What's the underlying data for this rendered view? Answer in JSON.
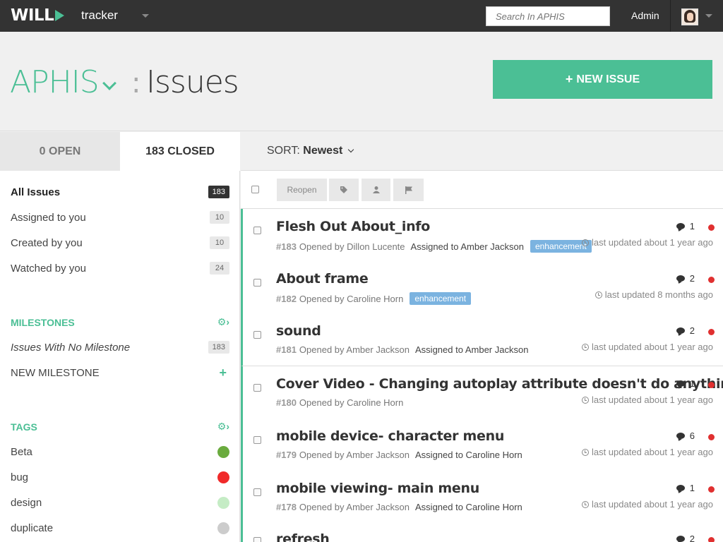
{
  "topbar": {
    "logo_text": "WILL",
    "app_name": "tracker",
    "search_placeholder": "Search In APHIS",
    "admin_label": "Admin"
  },
  "header": {
    "project": "APHIS",
    "separator": ":",
    "title": "Issues",
    "new_issue_plus": "+",
    "new_issue_label": "NEW ISSUE"
  },
  "tabs": {
    "open": "0 OPEN",
    "closed": "183 CLOSED"
  },
  "sort": {
    "label": "SORT:",
    "value": "Newest"
  },
  "filters": [
    {
      "label": "All Issues",
      "count": "183"
    },
    {
      "label": "Assigned to you",
      "count": "10"
    },
    {
      "label": "Created by you",
      "count": "10"
    },
    {
      "label": "Watched by you",
      "count": "24"
    }
  ],
  "milestones": {
    "title": "MILESTONES",
    "gear": "⚙›",
    "no_milestone_label": "Issues With No Milestone",
    "no_milestone_count": "183",
    "new_label": "NEW MILESTONE",
    "new_plus": "+"
  },
  "tags": {
    "title": "TAGS",
    "gear": "⚙›",
    "items": [
      {
        "label": "Beta",
        "color": "#6aab3e"
      },
      {
        "label": "bug",
        "color": "#f02a2a"
      },
      {
        "label": "design",
        "color": "#c5ecc5"
      },
      {
        "label": "duplicate",
        "color": "#cccccc"
      }
    ]
  },
  "toolbar": {
    "reopen": "Reopen",
    "tag_icon": "tag-icon",
    "user_icon": "user-icon",
    "flag_icon": "flag-icon"
  },
  "issues": [
    {
      "title": "Flesh Out About_info",
      "number": "#183",
      "opened": "Opened by Dillon Lucente",
      "assigned": "Assigned to Amber Jackson",
      "label": "enhancement",
      "comments": "1",
      "updated": "last updated about 1 year ago"
    },
    {
      "title": "About frame",
      "number": "#182",
      "opened": "Opened by Caroline Horn",
      "assigned": "",
      "label": "enhancement",
      "comments": "2",
      "updated": "last updated 8 months ago"
    },
    {
      "title": "sound",
      "number": "#181",
      "opened": "Opened by Amber Jackson",
      "assigned": "Assigned to Amber Jackson",
      "label": "",
      "comments": "2",
      "updated": "last updated about 1 year ago"
    },
    {
      "title": "Cover Video - Changing autoplay attribute doesn't do anything",
      "number": "#180",
      "opened": "Opened by Caroline Horn",
      "assigned": "",
      "label": "",
      "comments": "1",
      "updated": "last updated about 1 year ago"
    },
    {
      "title": "mobile device- character menu",
      "number": "#179",
      "opened": "Opened by Amber Jackson",
      "assigned": "Assigned to Caroline Horn",
      "label": "",
      "comments": "6",
      "updated": "last updated about 1 year ago"
    },
    {
      "title": "mobile viewing- main menu",
      "number": "#178",
      "opened": "Opened by Amber Jackson",
      "assigned": "Assigned to Caroline Horn",
      "label": "",
      "comments": "1",
      "updated": "last updated about 1 year ago"
    },
    {
      "title": "refresh",
      "number": "",
      "opened": "",
      "assigned": "",
      "label": "",
      "comments": "2",
      "updated": ""
    }
  ]
}
